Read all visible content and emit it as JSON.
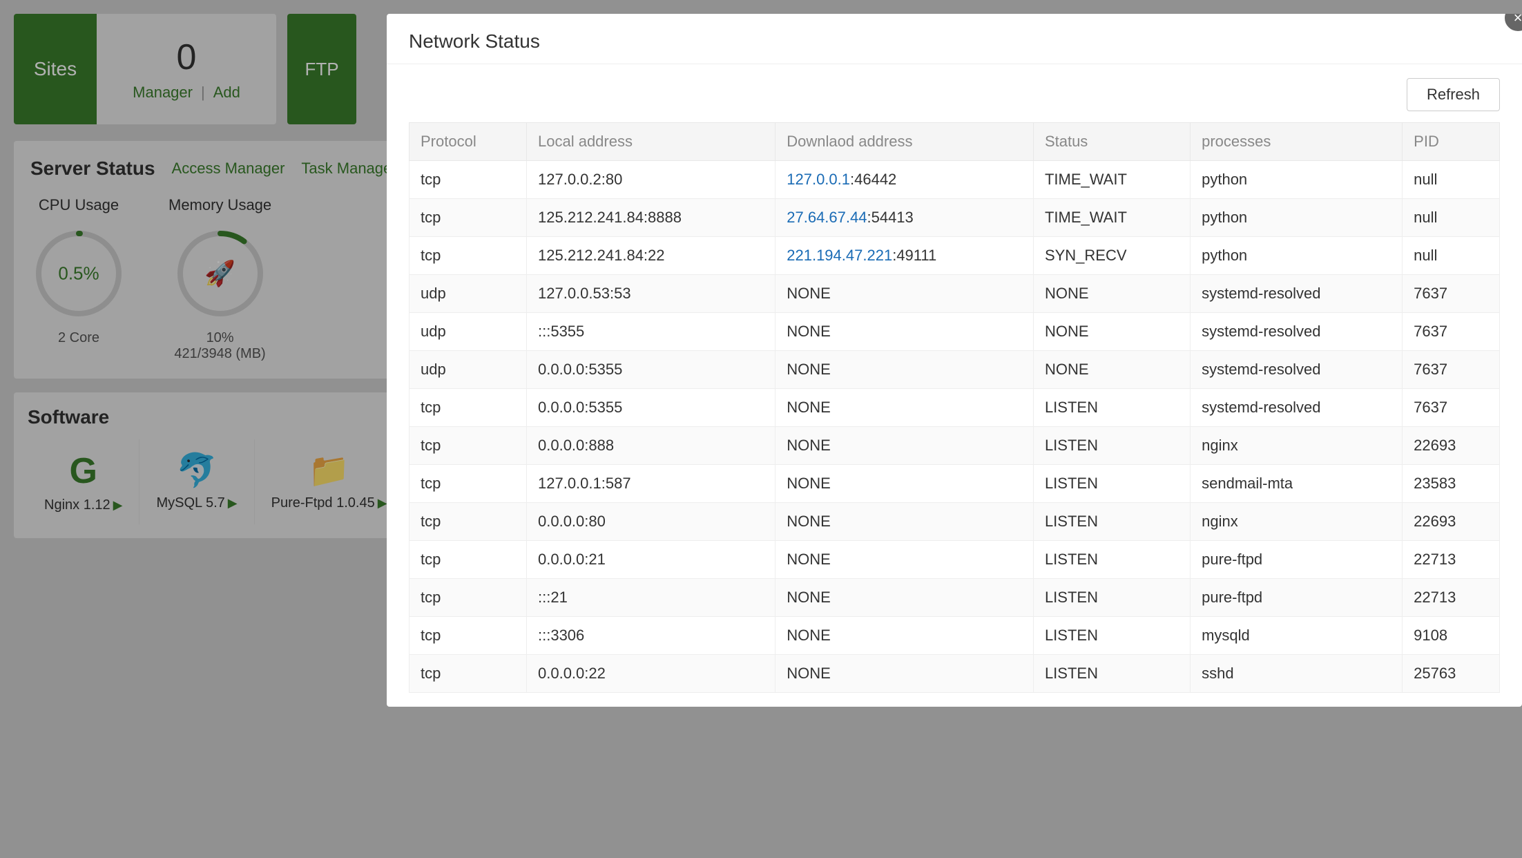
{
  "dashboard": {
    "sites_label": "Sites",
    "sites_count": "0",
    "manager_link": "Manager",
    "add_link": "Add",
    "ftp_label": "FTP",
    "server_status_title": "Server Status",
    "access_manager_link": "Access Manager",
    "task_manager_link": "Task Manager",
    "cpu_label": "CPU Usage",
    "cpu_value": "0.5%",
    "cpu_cores": "2 Core",
    "memory_label": "Memory Usage",
    "memory_value": "10%",
    "memory_usage": "421/3948 (MB)",
    "software_title": "Software",
    "nginx_name": "Nginx 1.12",
    "mysql_name": "MySQL 5.7",
    "pureftpd_name": "Pure-Ftpd 1.0.45"
  },
  "modal": {
    "title": "Network Status",
    "refresh_label": "Refresh",
    "close_label": "×",
    "columns": {
      "protocol": "Protocol",
      "local_address": "Local address",
      "download_address": "Downlaod address",
      "status": "Status",
      "processes": "processes",
      "pid": "PID"
    },
    "rows": [
      {
        "protocol": "tcp",
        "local_address": "127.0.0.2:80",
        "download_address": "127.0.0.1:46442",
        "download_is_link": true,
        "download_link_part": "127.0.0.1",
        "download_rest": ":46442",
        "status": "TIME_WAIT",
        "processes": "python",
        "pid": "null"
      },
      {
        "protocol": "tcp",
        "local_address": "125.212.241.84:8888",
        "download_address": "27.64.67.44:54413",
        "download_is_link": true,
        "download_link_part": "27.64.67.44",
        "download_rest": ":54413",
        "status": "TIME_WAIT",
        "processes": "python",
        "pid": "null"
      },
      {
        "protocol": "tcp",
        "local_address": "125.212.241.84:22",
        "download_address": "221.194.47.221:49111",
        "download_is_link": true,
        "download_link_part": "221.194.47.221",
        "download_rest": ":49111",
        "status": "SYN_RECV",
        "processes": "python",
        "pid": "null"
      },
      {
        "protocol": "udp",
        "local_address": "127.0.0.53:53",
        "download_address": "NONE",
        "download_is_link": false,
        "status": "NONE",
        "processes": "systemd-resolved",
        "pid": "7637"
      },
      {
        "protocol": "udp",
        "local_address": ":::5355",
        "download_address": "NONE",
        "download_is_link": false,
        "status": "NONE",
        "processes": "systemd-resolved",
        "pid": "7637"
      },
      {
        "protocol": "udp",
        "local_address": "0.0.0.0:5355",
        "download_address": "NONE",
        "download_is_link": false,
        "status": "NONE",
        "processes": "systemd-resolved",
        "pid": "7637"
      },
      {
        "protocol": "tcp",
        "local_address": "0.0.0.0:5355",
        "download_address": "NONE",
        "download_is_link": false,
        "status": "LISTEN",
        "processes": "systemd-resolved",
        "pid": "7637"
      },
      {
        "protocol": "tcp",
        "local_address": "0.0.0.0:888",
        "download_address": "NONE",
        "download_is_link": false,
        "status": "LISTEN",
        "processes": "nginx",
        "pid": "22693"
      },
      {
        "protocol": "tcp",
        "local_address": "127.0.0.1:587",
        "download_address": "NONE",
        "download_is_link": false,
        "status": "LISTEN",
        "processes": "sendmail-mta",
        "pid": "23583"
      },
      {
        "protocol": "tcp",
        "local_address": "0.0.0.0:80",
        "download_address": "NONE",
        "download_is_link": false,
        "status": "LISTEN",
        "processes": "nginx",
        "pid": "22693"
      },
      {
        "protocol": "tcp",
        "local_address": "0.0.0.0:21",
        "download_address": "NONE",
        "download_is_link": false,
        "status": "LISTEN",
        "processes": "pure-ftpd",
        "pid": "22713"
      },
      {
        "protocol": "tcp",
        "local_address": ":::21",
        "download_address": "NONE",
        "download_is_link": false,
        "status": "LISTEN",
        "processes": "pure-ftpd",
        "pid": "22713"
      },
      {
        "protocol": "tcp",
        "local_address": ":::3306",
        "download_address": "NONE",
        "download_is_link": false,
        "status": "LISTEN",
        "processes": "mysqld",
        "pid": "9108"
      },
      {
        "protocol": "tcp",
        "local_address": "0.0.0.0:22",
        "download_address": "NONE",
        "download_is_link": false,
        "status": "LISTEN",
        "processes": "sshd",
        "pid": "25763"
      }
    ]
  }
}
